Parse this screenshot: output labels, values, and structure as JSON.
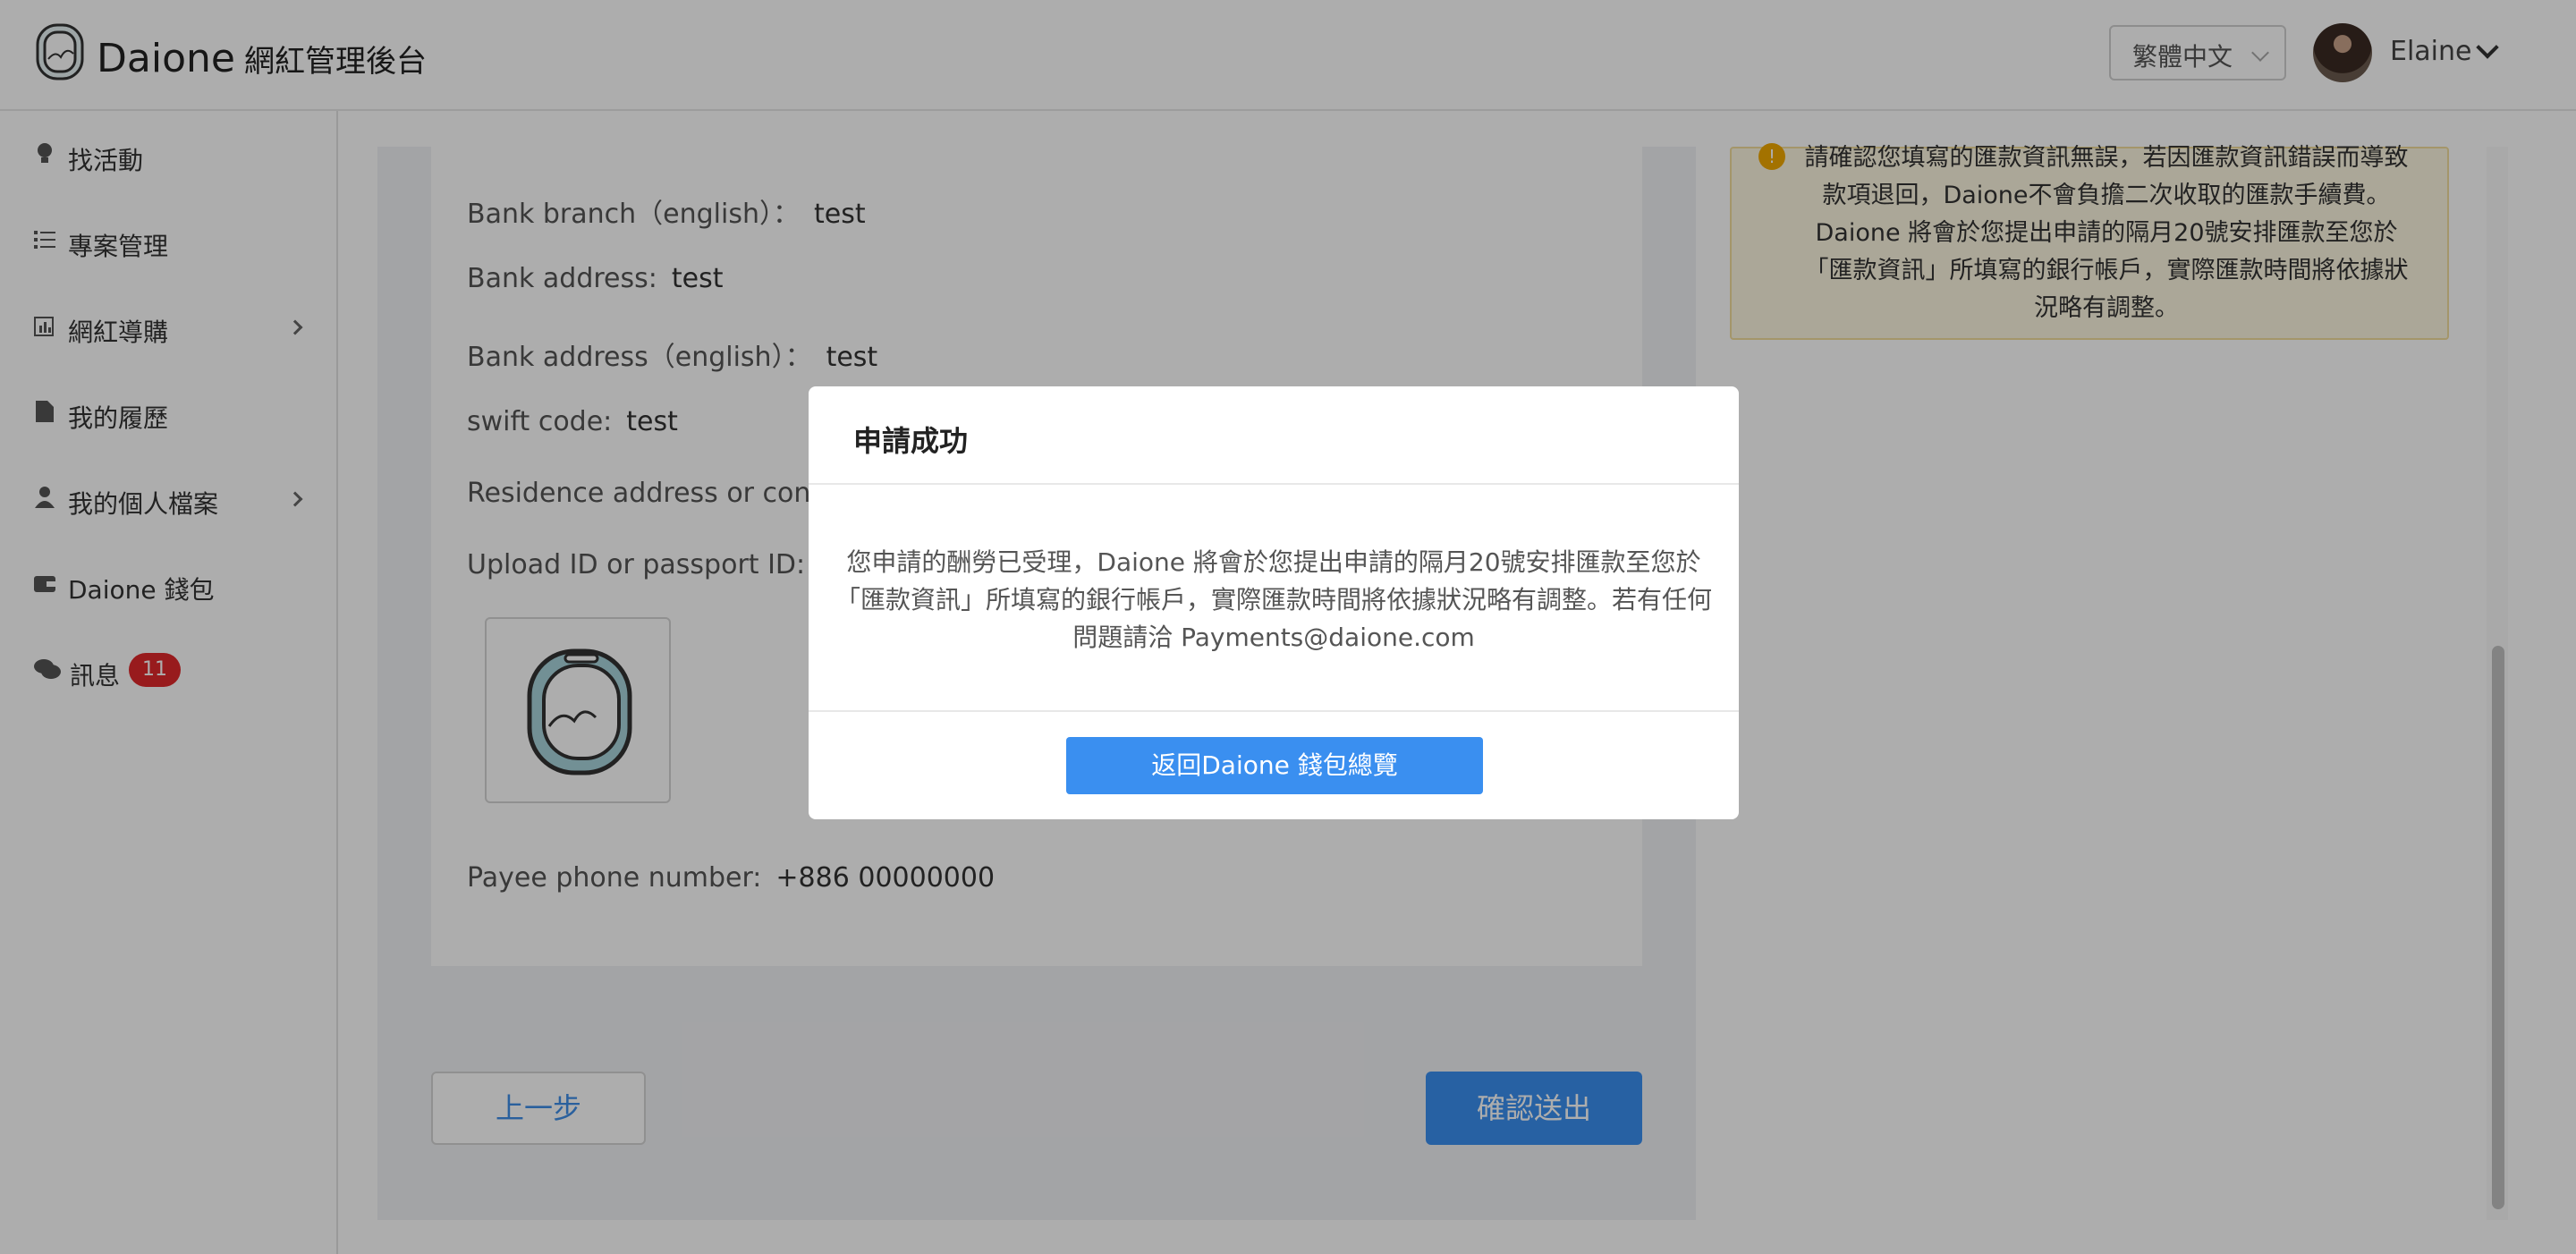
{
  "header": {
    "brand": "Daione",
    "brand_sub": "網紅管理後台",
    "language": "繁體中文",
    "user_name": "Elaine"
  },
  "sidebar": {
    "items": [
      {
        "label": "找活動",
        "icon": "lightbulb-icon"
      },
      {
        "label": "專案管理",
        "icon": "list-icon"
      },
      {
        "label": "網紅導購",
        "icon": "chart-icon"
      },
      {
        "label": "我的履歷",
        "icon": "document-icon"
      },
      {
        "label": "我的個人檔案",
        "icon": "user-icon"
      },
      {
        "label": "Daione 錢包",
        "icon": "wallet-icon"
      },
      {
        "label": "訊息",
        "icon": "chat-icon",
        "badge": "11"
      }
    ]
  },
  "form": {
    "fields": [
      {
        "label": "Bank branch（english）：",
        "value": "test"
      },
      {
        "label": "Bank address:",
        "value": "test"
      },
      {
        "label": "Bank address（english）：",
        "value": "test"
      },
      {
        "label": "swift code:",
        "value": "test"
      },
      {
        "label": "Residence address or conta",
        "value": ""
      },
      {
        "label": "Upload ID or passport ID:",
        "value": ""
      },
      {
        "label": "Payee phone number:",
        "value": "+886 00000000"
      }
    ],
    "prev_button": "上一步",
    "submit_button": "確認送出"
  },
  "notice": {
    "text": "請確認您填寫的匯款資訊無誤，若因匯款資訊錯誤而導致款項退回，Daione不會負擔二次收取的匯款手續費。Daione 將會於您提出申請的隔月20號安排匯款至您於「匯款資訊」所填寫的銀行帳戶，實際匯款時間將依據狀況略有調整。"
  },
  "modal": {
    "title": "申請成功",
    "body": "您申請的酬勞已受理，Daione 將會於您提出申請的隔月20號安排匯款至您於「匯款資訊」所填寫的銀行帳戶，實際匯款時間將依據狀況略有調整。若有任何問題請洽 Payments@daione.com",
    "button": "返回Daione 錢包總覽"
  },
  "colors": {
    "primary": "#3a8ff0",
    "badge": "#e0292b",
    "notice_bg": "#fdf6e0"
  }
}
